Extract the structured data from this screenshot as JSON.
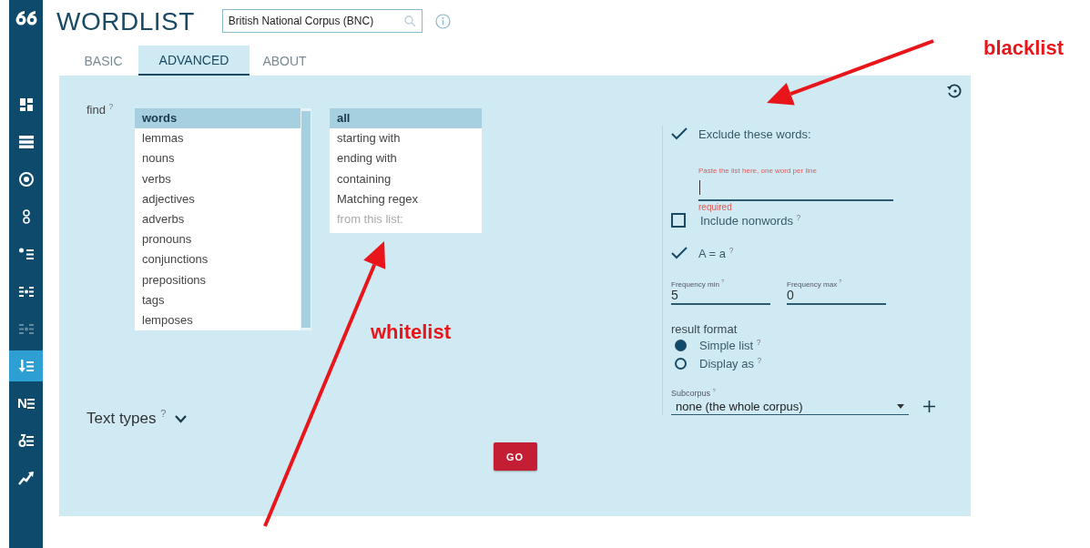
{
  "sidebar": {
    "items": [
      {
        "selected": false,
        "disabled": false
      },
      {
        "selected": false,
        "disabled": false
      },
      {
        "selected": false,
        "disabled": false
      },
      {
        "selected": false,
        "disabled": false
      },
      {
        "selected": false,
        "disabled": false
      },
      {
        "selected": false,
        "disabled": false
      },
      {
        "selected": false,
        "disabled": true
      },
      {
        "selected": true,
        "disabled": false
      },
      {
        "selected": false,
        "disabled": false,
        "text": "N"
      },
      {
        "selected": false,
        "disabled": false
      },
      {
        "selected": false,
        "disabled": false
      }
    ]
  },
  "header": {
    "title": "WORDLIST",
    "corpus_field": {
      "value": "British National Corpus (BNC)"
    }
  },
  "tabs": [
    {
      "label": "BASIC",
      "selected": false
    },
    {
      "label": "ADVANCED",
      "selected": true
    },
    {
      "label": "ABOUT",
      "selected": false
    }
  ],
  "form": {
    "find_label": "find $^{?}$",
    "attribute_list": [
      {
        "label": "words",
        "selected": true
      },
      {
        "label": "lemmas",
        "selected": false
      },
      {
        "label": "nouns",
        "selected": false
      },
      {
        "label": "verbs",
        "selected": false
      },
      {
        "label": "adjectives",
        "selected": false
      },
      {
        "label": "adverbs",
        "selected": false
      },
      {
        "label": "pronouns",
        "selected": false
      },
      {
        "label": "conjunctions",
        "selected": false
      },
      {
        "label": "prepositions",
        "selected": false
      },
      {
        "label": "tags",
        "selected": false
      },
      {
        "label": "lemposes",
        "selected": false
      }
    ],
    "filter_list": [
      {
        "label": "all",
        "selected": true,
        "disabled": false
      },
      {
        "label": "starting with",
        "selected": false,
        "disabled": false
      },
      {
        "label": "ending with",
        "selected": false,
        "disabled": false
      },
      {
        "label": "containing",
        "selected": false,
        "disabled": false
      },
      {
        "label": "Matching regex",
        "selected": false,
        "disabled": false
      },
      {
        "label": "from this list:",
        "selected": false,
        "disabled": true
      }
    ],
    "exclude": {
      "label": "Exclude these words:",
      "checked": true
    },
    "exclude_field": {
      "label": "Paste the list here, one word per line",
      "error": "required"
    },
    "nonwords": {
      "label": "Include nonwords $^{?}$",
      "checked": false
    },
    "case": {
      "label": "A = a $^{?}$",
      "checked": true
    },
    "frequency_min": {
      "label": "Frequency min $^{?}$",
      "value": "5"
    },
    "frequency_max": {
      "label": "Frequency max $^{?}$",
      "value": "0"
    },
    "result_format": {
      "label": "result format",
      "options": [
        {
          "label": "Simple list $^{?}$",
          "selected": true
        },
        {
          "label": "Display as $^{?}$",
          "selected": false
        }
      ]
    },
    "subcorpus": {
      "label": "Subcorpus $^{?}$",
      "value": "none (the whole corpus)"
    },
    "text_types": {
      "label": "Text types $^{?}$",
      "expanded": false
    },
    "go_button": "GO"
  },
  "annotations": [
    {
      "text": "blacklist"
    },
    {
      "text": "whitelist"
    }
  ]
}
